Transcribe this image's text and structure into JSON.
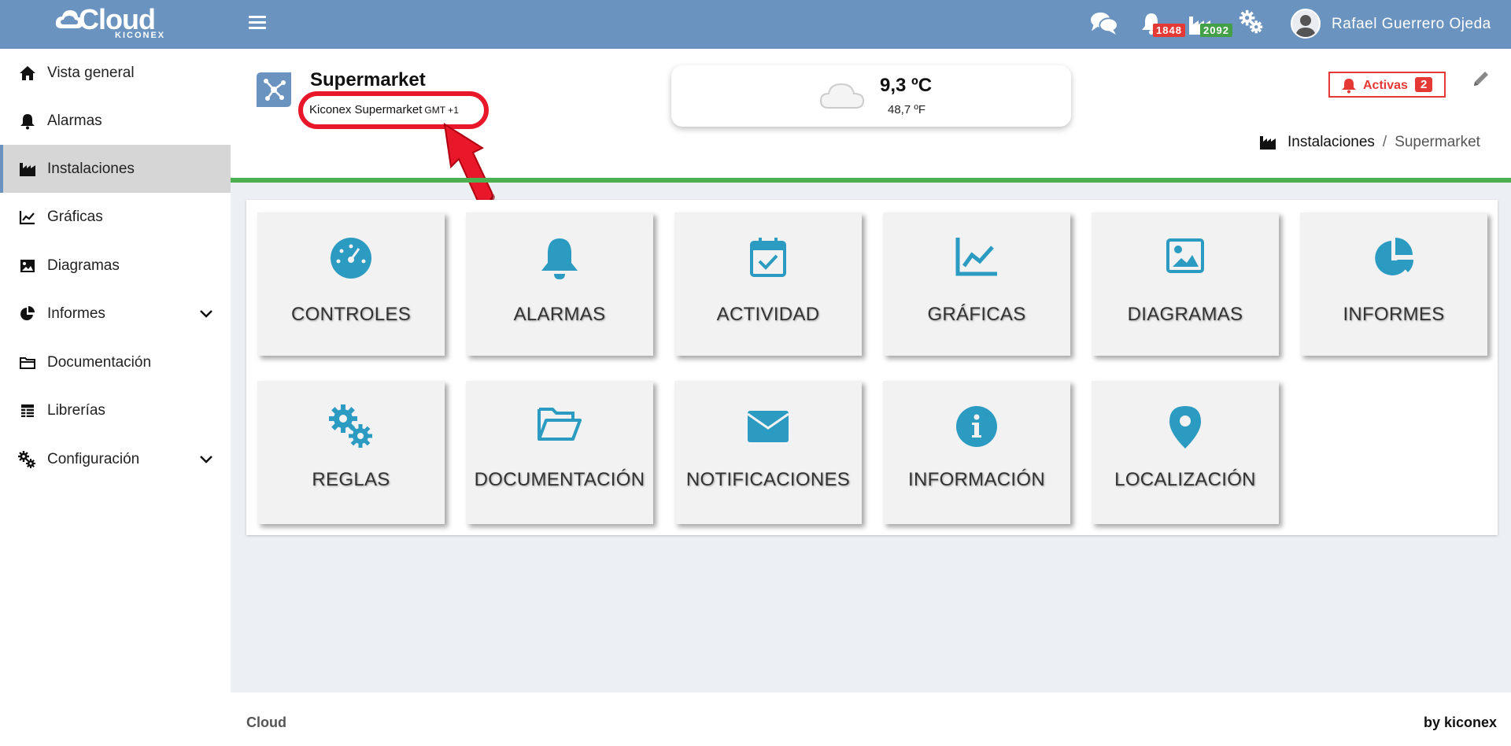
{
  "app": {
    "logo_text": "Cloud",
    "logo_sub": "KICONEX",
    "brand_color": "#6a93bf"
  },
  "topbar": {
    "alarms_badge": "1848",
    "installations_badge": "2092",
    "user_name": "Rafael Guerrero Ojeda"
  },
  "sidebar": {
    "items": [
      {
        "label": "Vista general",
        "icon": "home-icon"
      },
      {
        "label": "Alarmas",
        "icon": "bell-icon"
      },
      {
        "label": "Instalaciones",
        "icon": "factory-icon",
        "active": true
      },
      {
        "label": "Gráficas",
        "icon": "line-chart-icon"
      },
      {
        "label": "Diagramas",
        "icon": "image-icon"
      },
      {
        "label": "Informes",
        "icon": "pie-chart-icon",
        "expandable": true
      },
      {
        "label": "Documentación",
        "icon": "folder-icon"
      },
      {
        "label": "Librerías",
        "icon": "table-icon"
      },
      {
        "label": "Configuración",
        "icon": "gears-icon",
        "expandable": true
      }
    ]
  },
  "site": {
    "title": "Supermarket",
    "subtitle": "Kiconex Supermarket",
    "timezone": "GMT +1"
  },
  "weather": {
    "celsius": "9,3 ºC",
    "fahrenheit": "48,7 ºF"
  },
  "alarms_button": {
    "label": "Activas",
    "count": "2"
  },
  "breadcrumb": {
    "parent": "Instalaciones",
    "separator": "/",
    "current": "Supermarket"
  },
  "tiles": [
    {
      "label": "CONTROLES",
      "icon": "gauge-icon"
    },
    {
      "label": "ALARMAS",
      "icon": "bell-icon"
    },
    {
      "label": "ACTIVIDAD",
      "icon": "calendar-check-icon"
    },
    {
      "label": "GRÁFICAS",
      "icon": "line-chart-icon"
    },
    {
      "label": "DIAGRAMAS",
      "icon": "image-icon"
    },
    {
      "label": "INFORMES",
      "icon": "pie-chart-icon"
    },
    {
      "label": "REGLAS",
      "icon": "gears-icon"
    },
    {
      "label": "DOCUMENTACIÓN",
      "icon": "folder-open-icon"
    },
    {
      "label": "NOTIFICACIONES",
      "icon": "envelope-icon"
    },
    {
      "label": "INFORMACIÓN",
      "icon": "info-icon"
    },
    {
      "label": "LOCALIZACIÓN",
      "icon": "map-marker-icon"
    }
  ],
  "footer": {
    "left": "Cloud",
    "right": "by kiconex"
  },
  "colors": {
    "tile_icon": "#2b9bc2",
    "accent_green": "#4caf50",
    "alert_red": "#e53935"
  }
}
